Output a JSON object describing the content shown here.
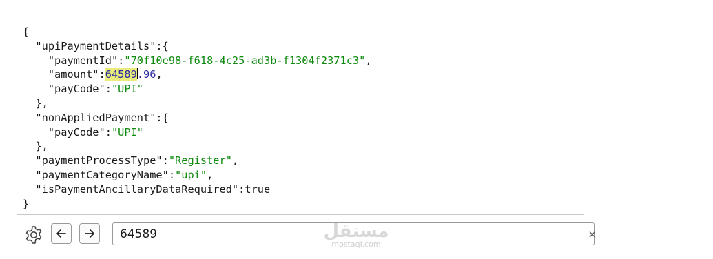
{
  "json_view": {
    "l1": "{",
    "l2_key": "\"upiPaymentDetails\"",
    "l2_rest": ":{",
    "l3_key": "\"paymentId\"",
    "l3_val": "\"70f10e98-f618-4c25-ad3b-f1304f2371c3\"",
    "l4_key": "\"amount\"",
    "l4_match": "64589",
    "l4_rest": ".96",
    "l5_key": "\"payCode\"",
    "l5_val": "\"UPI\"",
    "l6": "},",
    "l7_key": "\"nonAppliedPayment\"",
    "l7_rest": ":{",
    "l8_key": "\"payCode\"",
    "l8_val": "\"UPI\"",
    "l9": "},",
    "l10_key": "\"paymentProcessType\"",
    "l10_val": "\"Register\"",
    "l11_key": "\"paymentCategoryName\"",
    "l11_val": "\"upi\"",
    "l12_key": "\"isPaymentAncillaryDataRequired\"",
    "l12_val": "true",
    "l13": "}"
  },
  "find_bar": {
    "settings_icon": "gear-icon",
    "prev_icon": "arrow-left-icon",
    "next_icon": "arrow-right-icon",
    "query": "64589",
    "clear_glyph": "×"
  },
  "watermark": {
    "main": "مستقل",
    "sub": "mostaql.com"
  },
  "colors": {
    "string": "#0f8a0f",
    "number": "#2a2aa0",
    "highlight": "#e9ec7a"
  }
}
